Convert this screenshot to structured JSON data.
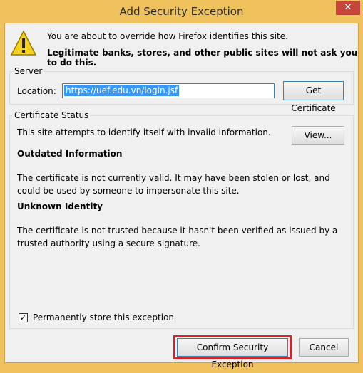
{
  "window": {
    "title": "Add Security Exception",
    "close_symbol": "✕"
  },
  "header": {
    "line1": "You are about to override how Firefox identifies this site.",
    "line2": "Legitimate banks, stores, and other public sites will not ask you to do this."
  },
  "server": {
    "group_label": "Server",
    "location_label": "Location:",
    "location_value": "https://uef.edu.vn/login.jsf",
    "get_certificate_label": "Get Certificate"
  },
  "status": {
    "group_label": "Certificate Status",
    "summary": "This site attempts to identify itself with invalid information.",
    "view_label": "View...",
    "outdated_heading": "Outdated Information",
    "outdated_text": "The certificate is not currently valid. It may have been stolen or lost, and could be used by someone to impersonate this site.",
    "unknown_heading": "Unknown Identity",
    "unknown_text": "The certificate is not trusted because it hasn't been verified as issued by a trusted authority using a secure signature."
  },
  "options": {
    "permanent_label": "Permanently store this exception",
    "permanent_checked": true
  },
  "buttons": {
    "confirm_label": "Confirm Security Exception",
    "cancel_label": "Cancel"
  },
  "colors": {
    "titlebar": "#f0c25e",
    "highlight": "#d2232a",
    "close": "#c7463c"
  },
  "icons": {
    "warning": "warning-icon"
  }
}
